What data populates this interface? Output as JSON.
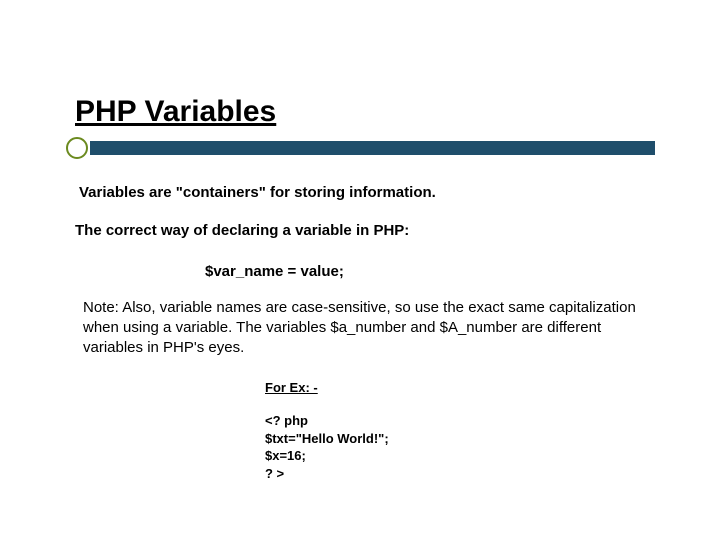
{
  "title": "PHP Variables",
  "intro": "Variables are \"containers\" for storing information.",
  "declare_intro": "The correct way of declaring a variable in PHP:",
  "syntax": "$var_name = value;",
  "note": "Note: Also, variable names are case-sensitive, so use the exact same capitalization when using a variable. The variables $a_number and $A_number are different variables in PHP's eyes.",
  "example_label": "For Ex: -",
  "code": {
    "l1": "<? php",
    "l2": "$txt=\"Hello World!\";",
    "l3": "$x=16;",
    "l4": "? >"
  }
}
